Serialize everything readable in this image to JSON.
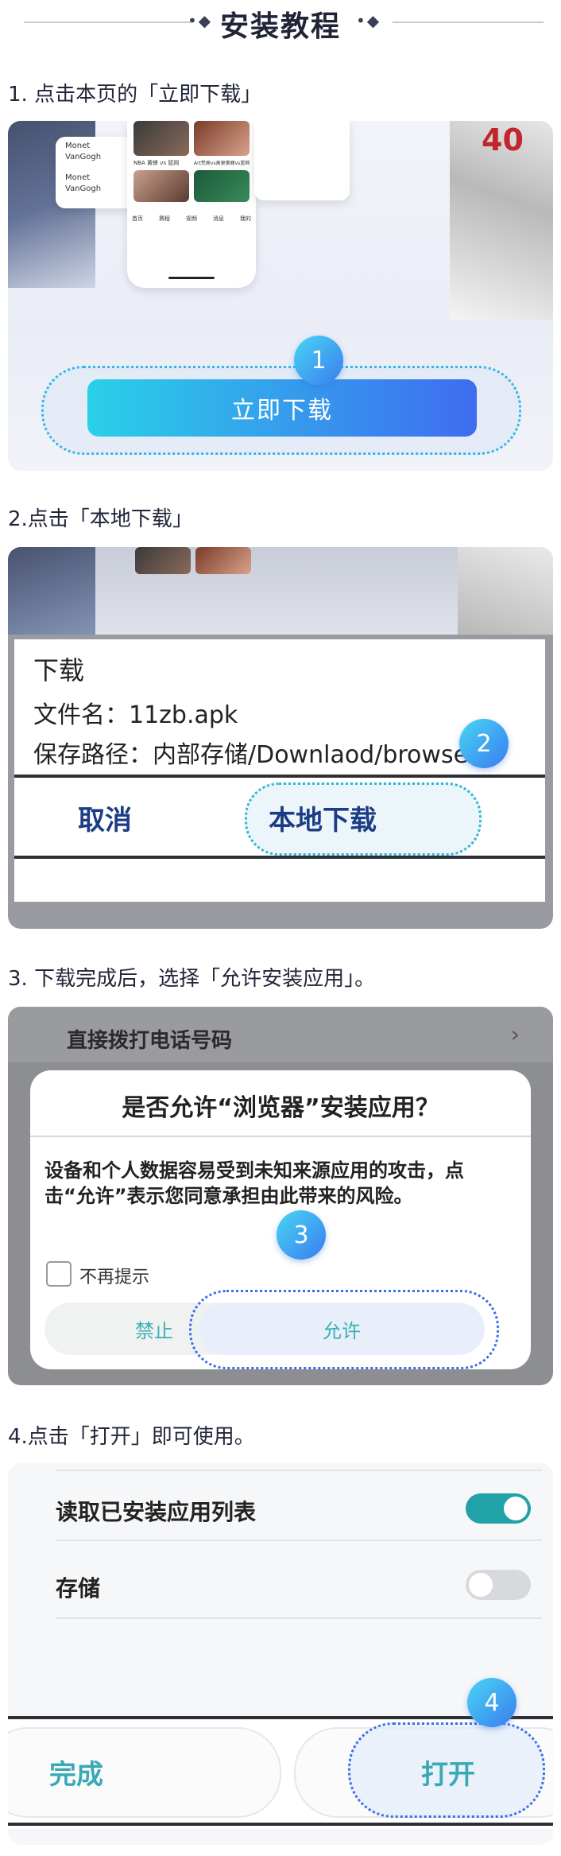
{
  "header": {
    "title": "安装教程",
    "dots": "•◆"
  },
  "steps": [
    {
      "text": "1. 点击本页的「立即下载」",
      "button": "立即下载",
      "badge": "1",
      "preview": {
        "name1": "Monet",
        "name2": "VanGogh",
        "card1": "NBA 黄蜂 vs 篮网",
        "card2": "Art梵高vs高更黄蜂vs篮网...",
        "jersey": "40",
        "nav": [
          "首页",
          "赛程",
          "视频",
          "消息",
          "我的"
        ]
      }
    },
    {
      "text": "2.点击「本地下载」",
      "dialog_title": "下载",
      "file_label": "文件名：11zb.apk",
      "path_label": "保存路径：内部存储/Downlaod/browse",
      "cancel": "取消",
      "local_download": "本地下载",
      "badge": "2"
    },
    {
      "text": "3. 下载完成后，选择「允许安装应用」。",
      "top_row": "直接拨打电话号码",
      "dialog_title": "是否允许“浏览器”安装应用？",
      "body": "设备和个人数据容易受到未知来源应用的攻击，点击“允许”表示您同意承担由此带来的风险。",
      "checkbox": "不再提示",
      "deny": "禁止",
      "allow": "允许",
      "badge": "3"
    },
    {
      "text": "4.点击「打开」即可使用。",
      "perm1": "读取已安装应用列表",
      "perm2": "存储",
      "done": "完成",
      "open": "打开",
      "badge": "4"
    }
  ],
  "colors": {
    "accent_start": "#2ad0e8",
    "accent_end": "#3f6cf0",
    "toggle_on": "#20a2a8",
    "toggle_off": "#d8d9dc"
  }
}
